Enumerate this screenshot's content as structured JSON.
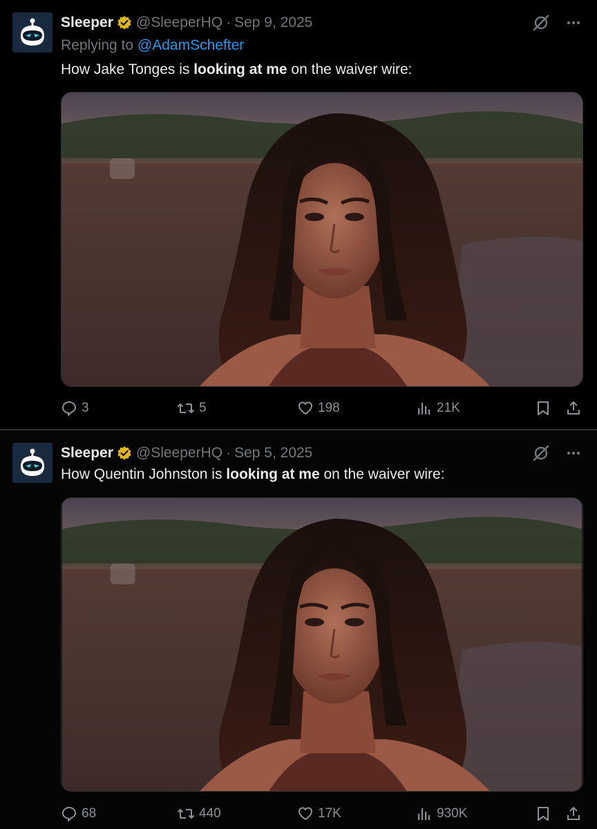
{
  "tweets": [
    {
      "name": "Sleeper",
      "handle": "@SleeperHQ",
      "separator": "·",
      "date": "Sep 9, 2025",
      "replying_prefix": "Replying to",
      "replying_to": "@AdamSchefter",
      "text_before": "How Jake Tonges is ",
      "text_bold": "looking at me",
      "text_after": " on the waiver wire:",
      "stats": {
        "replies": "3",
        "retweets": "5",
        "likes": "198",
        "views": "21K"
      }
    },
    {
      "name": "Sleeper",
      "handle": "@SleeperHQ",
      "separator": "·",
      "date": "Sep 5, 2025",
      "text_before": "How Quentin Johnston is ",
      "text_bold": "looking at me",
      "text_after": " on the waiver wire:",
      "stats": {
        "replies": "68",
        "retweets": "440",
        "likes": "17K",
        "views": "930K"
      }
    }
  ],
  "icons": {
    "verified": "verified-badge-gold",
    "grok": "grok-icon",
    "more": "more-icon",
    "reply": "reply-icon",
    "retweet": "retweet-icon",
    "like": "heart-icon",
    "views": "views-icon",
    "bookmark": "bookmark-icon",
    "share": "share-icon"
  },
  "colors": {
    "background": "#000000",
    "text": "#e7e9ea",
    "secondary": "#71767b",
    "link": "#1d9bf0",
    "verified_gold": "#e2b719",
    "divider": "#2f3336"
  }
}
